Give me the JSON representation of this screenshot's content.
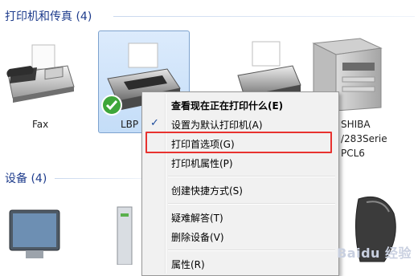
{
  "sections": {
    "printers": {
      "title": "打印机和传真 (4)"
    },
    "devices": {
      "title": "设备 (4)"
    }
  },
  "printers": [
    {
      "label": "Fax",
      "icon": "fax-icon"
    },
    {
      "label": "LBP",
      "icon": "default-printer-icon",
      "selected": true
    },
    {
      "label": "",
      "icon": "printer-icon"
    },
    {
      "label_lines": [
        "SHIBA",
        "/283Serie",
        "PCL6"
      ],
      "icon": "multifunction-printer-icon"
    }
  ],
  "context_menu": {
    "items": [
      {
        "label": "查看现在正在打印什么(E)",
        "bold": true
      },
      {
        "label": "设置为默认打印机(A)",
        "checked": true
      },
      {
        "label": "打印首选项(G)",
        "highlighted": true
      },
      {
        "label": "打印机属性(P)"
      },
      {
        "label": "创建快捷方式(S)"
      },
      {
        "label": "疑难解答(T)"
      },
      {
        "label": "删除设备(V)"
      },
      {
        "label": "属性(R)"
      }
    ],
    "check_glyph": "✓"
  },
  "watermark": "Baidu 经验",
  "colors": {
    "header": "#1e3c8c",
    "highlight": "#e8322f",
    "selection": "#c4ddf8"
  }
}
